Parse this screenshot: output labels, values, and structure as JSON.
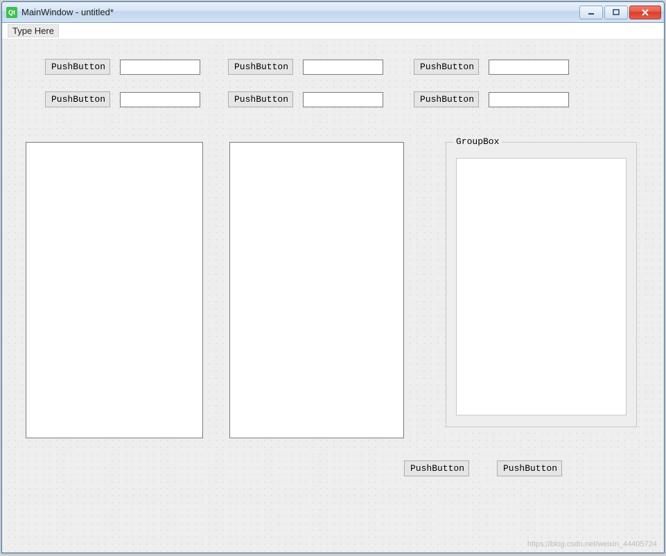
{
  "window": {
    "title": "MainWindow - untitled*",
    "icon_label": "Qt"
  },
  "menubar": {
    "type_here": "Type Here"
  },
  "buttons": {
    "r1c1": "PushButton",
    "r1c2": "PushButton",
    "r1c3": "PushButton",
    "r2c1": "PushButton",
    "r2c2": "PushButton",
    "r2c3": "PushButton",
    "bottom1": "PushButton",
    "bottom2": "PushButton"
  },
  "groupbox": {
    "title": "GroupBox"
  },
  "watermark": "https://blog.csdn.net/weixin_44405724"
}
